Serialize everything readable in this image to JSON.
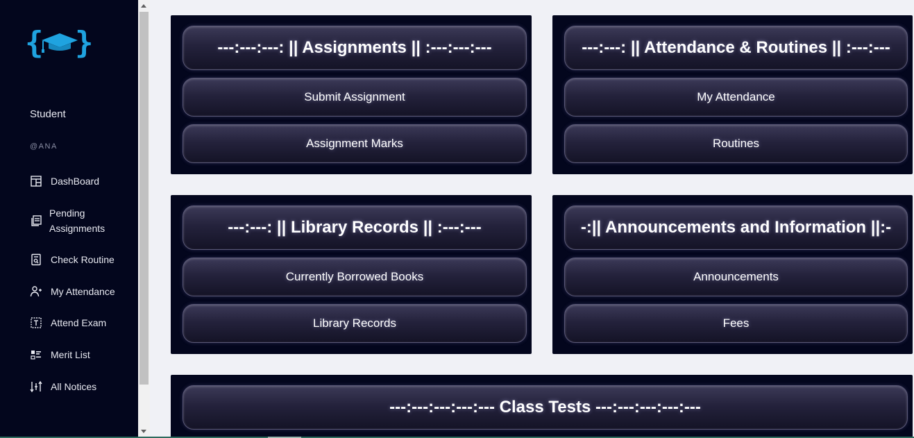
{
  "sidebar": {
    "role": "Student",
    "handle": "@ANA",
    "items": [
      {
        "label": "DashBoard",
        "icon": "dashboard-icon"
      },
      {
        "label": "Pending Assignments",
        "icon": "assignments-icon"
      },
      {
        "label": "Check Routine",
        "icon": "routine-icon"
      },
      {
        "label": "My Attendance",
        "icon": "attendance-icon"
      },
      {
        "label": "Attend Exam",
        "icon": "exam-icon"
      },
      {
        "label": "Merit List",
        "icon": "merit-list-icon"
      },
      {
        "label": "All Notices",
        "icon": "notices-icon"
      }
    ]
  },
  "cards": {
    "assignments": {
      "title": "---:---:---: || Assignments || :---:---:---",
      "buttons": [
        "Submit Assignment",
        "Assignment Marks"
      ]
    },
    "attendance": {
      "title": "---:---: || Attendance & Routines || :---:---",
      "buttons": [
        "My Attendance",
        "Routines"
      ]
    },
    "library": {
      "title": "---:---: || Library Records || :---:---",
      "buttons": [
        "Currently Borrowed Books",
        "Library Records"
      ]
    },
    "announcements": {
      "title": "-:|| Announcements and Information ||:-",
      "buttons": [
        "Announcements",
        "Fees"
      ]
    },
    "class_tests": {
      "title": "---:---:---:---:--- Class Tests ---:---:---:---:---"
    }
  },
  "colors": {
    "sidebar_bg": "#03061d",
    "page_bg": "#f0f1f6",
    "logo_accent": "#1fa3e0"
  }
}
